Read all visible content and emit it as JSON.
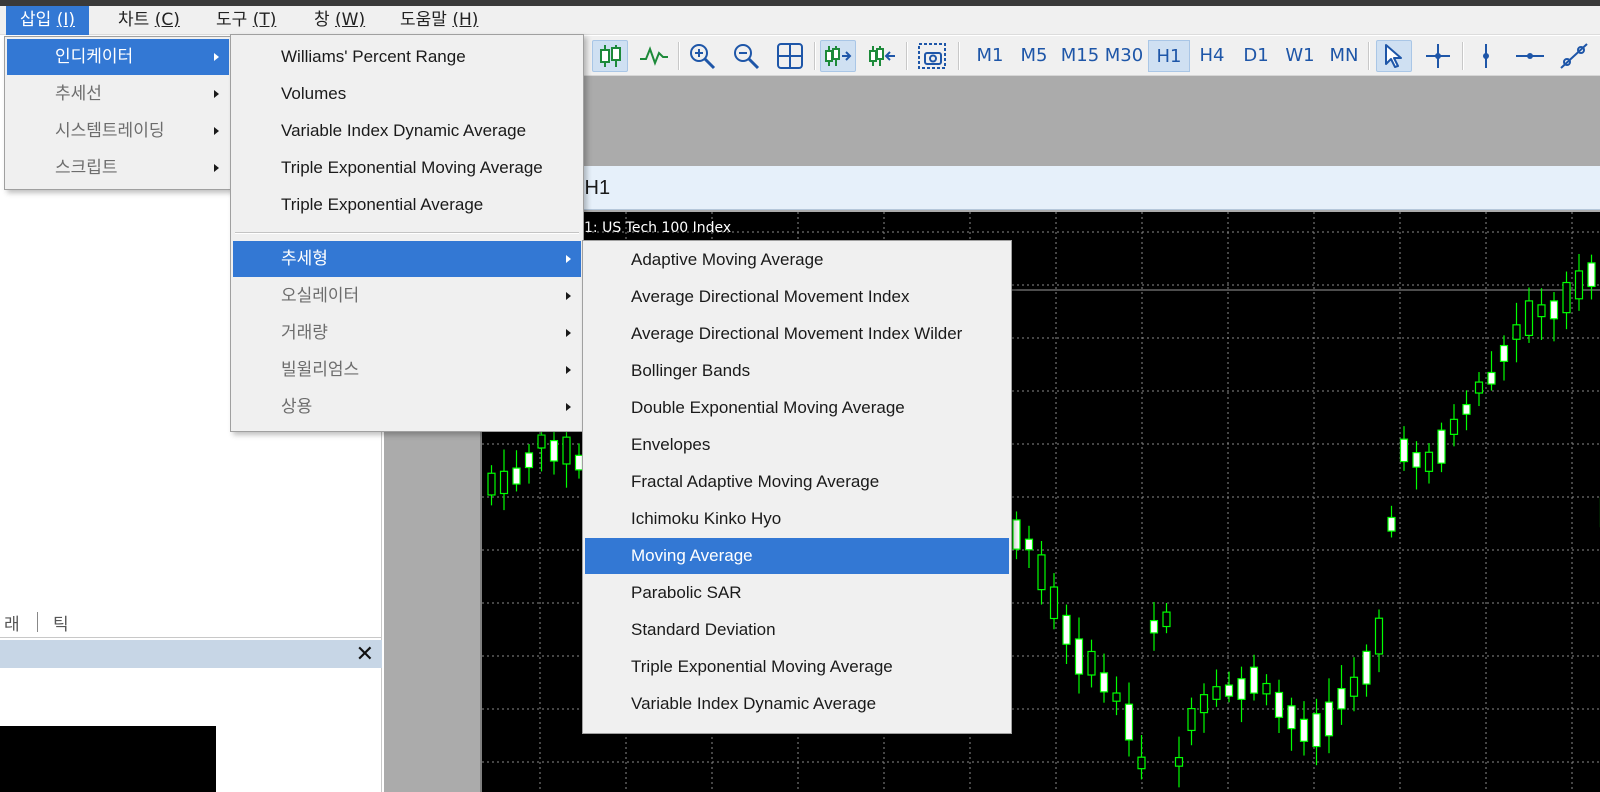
{
  "menubar": {
    "items": [
      {
        "label": "삽입",
        "key": "(I)"
      },
      {
        "label": "차트",
        "key": "(C)"
      },
      {
        "label": "도구",
        "key": "(T)"
      },
      {
        "label": "창",
        "key": "(W)"
      },
      {
        "label": "도움말",
        "key": "(H)"
      }
    ]
  },
  "toolbar": {
    "timeframes": [
      "M1",
      "M5",
      "M15",
      "M30",
      "H1",
      "H4",
      "D1",
      "W1",
      "MN"
    ],
    "selected_timeframe": "H1",
    "icons": [
      "candlestick-icon",
      "line-chart-icon",
      "zoom-in-icon",
      "zoom-out-icon",
      "tile-windows-icon",
      "auto-scroll-icon",
      "chart-shift-icon",
      "screenshot-icon",
      "cursor-icon",
      "crosshair-icon",
      "vertical-line-icon",
      "horizontal-line-icon",
      "trend-line-icon"
    ]
  },
  "chart": {
    "title_suffix": ",H1",
    "symbol_label": "1:  US Tech 100 Index"
  },
  "bottom_panel": {
    "tab1": "래",
    "tab2": "틱",
    "close": "✕"
  },
  "menu_insert": {
    "items": [
      {
        "label": "인디케이터",
        "submenu": true,
        "highlighted": true,
        "disabled": false
      },
      {
        "label": "추세선",
        "submenu": true,
        "highlighted": false,
        "disabled": true
      },
      {
        "label": "시스템트레이딩",
        "submenu": true,
        "highlighted": false,
        "disabled": true
      },
      {
        "label": "스크립트",
        "submenu": true,
        "highlighted": false,
        "disabled": true
      }
    ]
  },
  "menu_indicators": {
    "recent": [
      "Williams' Percent Range",
      "Volumes",
      "Variable Index Dynamic Average",
      "Triple Exponential Moving Average",
      "Triple Exponential Average"
    ],
    "categories": [
      {
        "label": "추세형",
        "highlighted": true,
        "disabled": false
      },
      {
        "label": "오실레이터",
        "highlighted": false,
        "disabled": true
      },
      {
        "label": "거래량",
        "highlighted": false,
        "disabled": true
      },
      {
        "label": "빌윌리엄스",
        "highlighted": false,
        "disabled": true
      },
      {
        "label": "상용",
        "highlighted": false,
        "disabled": true
      }
    ]
  },
  "menu_trend": {
    "items": [
      "Adaptive Moving Average",
      "Average Directional Movement Index",
      "Average Directional Movement Index Wilder",
      "Bollinger Bands",
      "Double Exponential Moving Average",
      "Envelopes",
      "Fractal Adaptive Moving Average",
      "Ichimoku Kinko Hyo",
      "Moving Average",
      "Parabolic SAR",
      "Standard Deviation",
      "Triple Exponential Moving Average",
      "Variable Index Dynamic Average"
    ],
    "highlighted": "Moving Average"
  },
  "colors": {
    "highlight": "#3378d4",
    "menu_bg": "#f0f0f0",
    "chart_bg": "#000000",
    "bull_candle": "#ffffff",
    "candle_outline": "#00ff00",
    "toolbar_text": "#1e56a8"
  }
}
